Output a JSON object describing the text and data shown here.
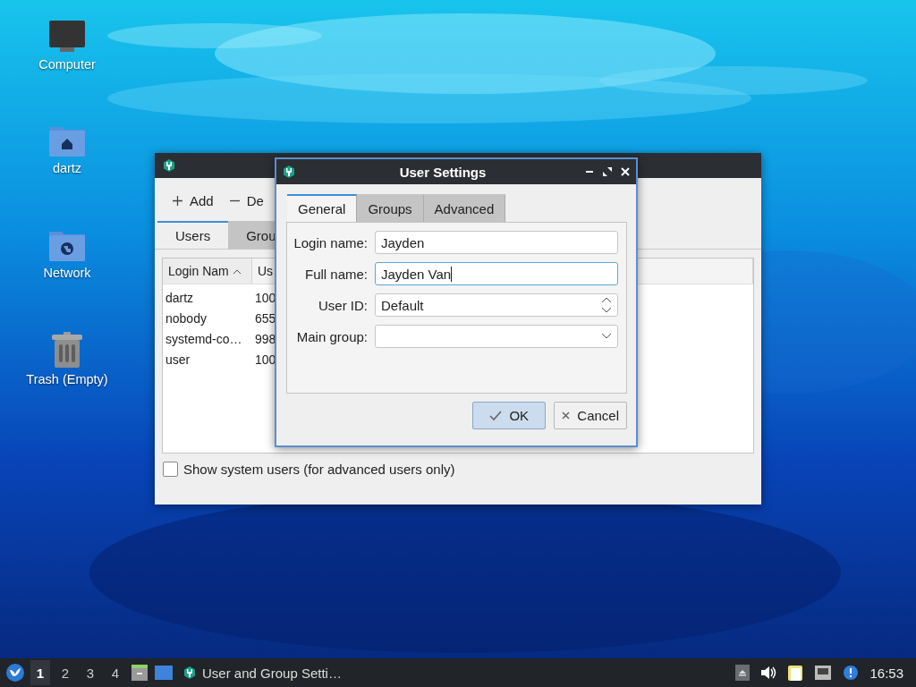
{
  "desktop_icons": [
    {
      "label": "Computer",
      "kind": "computer"
    },
    {
      "label": "dartz",
      "kind": "home"
    },
    {
      "label": "Network",
      "kind": "network"
    },
    {
      "label": "Trash (Empty)",
      "kind": "trash"
    }
  ],
  "main_window": {
    "toolbar": [
      {
        "label": "Add",
        "kind": "add"
      },
      {
        "label": "De",
        "kind": "remove"
      }
    ],
    "tabs": [
      {
        "label": "Users",
        "selected": true
      },
      {
        "label": "Grou",
        "selected": false
      }
    ],
    "table": {
      "columns": [
        {
          "label": "Login Nam",
          "sorted": true
        },
        {
          "label": "Us"
        }
      ],
      "rows": [
        [
          "dartz",
          "100"
        ],
        [
          "nobody",
          "655"
        ],
        [
          "systemd-co…",
          "998"
        ],
        [
          "user",
          "100"
        ]
      ]
    },
    "show_system_users": {
      "label": "Show system users (for advanced users only)",
      "checked": false
    }
  },
  "dialog": {
    "title": "User Settings",
    "tabs": [
      {
        "label": "General",
        "selected": true
      },
      {
        "label": "Groups",
        "selected": false
      },
      {
        "label": "Advanced",
        "selected": false
      }
    ],
    "fields": [
      {
        "label": "Login name:",
        "kind": "text",
        "value": "Jayden",
        "focused": false
      },
      {
        "label": "Full name:",
        "kind": "text",
        "value": "Jayden Van",
        "focused": true
      },
      {
        "label": "User ID:",
        "kind": "spin",
        "value": "Default",
        "focused": false
      },
      {
        "label": "Main group:",
        "kind": "combo",
        "focused": false
      }
    ],
    "buttons": [
      {
        "label": "OK",
        "kind": "ok",
        "default": true
      },
      {
        "label": "Cancel",
        "kind": "cancel",
        "default": false
      }
    ]
  },
  "taskbar": {
    "workspaces": [
      {
        "label": "1",
        "selected": true
      },
      {
        "label": "2",
        "selected": false
      },
      {
        "label": "3",
        "selected": false
      },
      {
        "label": "4",
        "selected": false
      }
    ],
    "task": {
      "label": "User and Group Setti…"
    },
    "clock": "16:53"
  }
}
